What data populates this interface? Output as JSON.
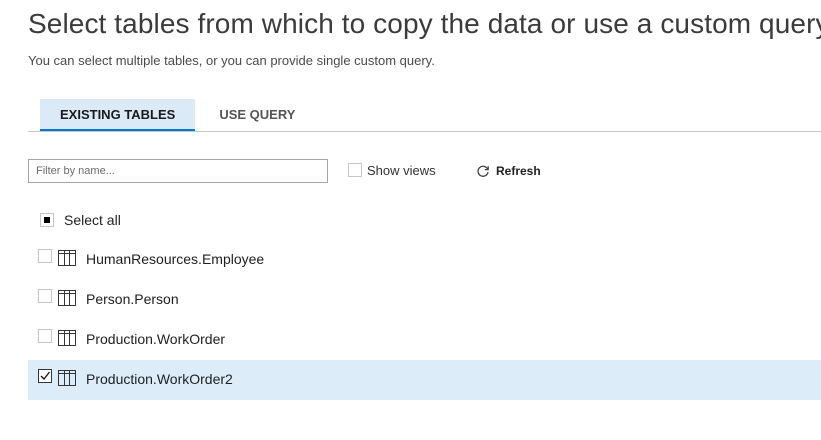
{
  "header": {
    "title": "Select tables from which to copy the data or use a custom query",
    "subtitle": "You can select multiple tables, or you can provide single custom query."
  },
  "tabs": [
    {
      "label": "EXISTING TABLES",
      "active": true
    },
    {
      "label": "USE QUERY",
      "active": false
    }
  ],
  "toolbar": {
    "filter_placeholder": "Filter by name...",
    "filter_value": "",
    "show_views_label": "Show views",
    "show_views_checked": false,
    "refresh_label": "Refresh",
    "refresh_icon": "refresh-icon"
  },
  "select_all": {
    "label": "Select all",
    "state": "indeterminate"
  },
  "tables": [
    {
      "name": "HumanResources.Employee",
      "checked": false,
      "icon": "table-icon"
    },
    {
      "name": "Person.Person",
      "checked": false,
      "icon": "table-icon"
    },
    {
      "name": "Production.WorkOrder",
      "checked": false,
      "icon": "table-icon"
    },
    {
      "name": "Production.WorkOrder2",
      "checked": true,
      "icon": "table-icon"
    }
  ],
  "colors": {
    "accent": "#0078d4",
    "active_tab_bg": "#dbeaf7",
    "selected_row_bg": "#dcedf9"
  }
}
